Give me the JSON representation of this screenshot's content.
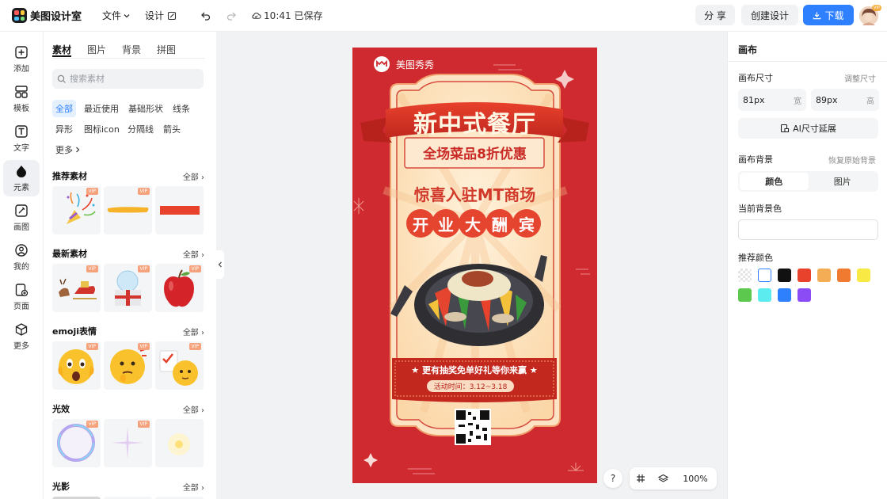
{
  "app": {
    "name": "美图设计室"
  },
  "menu": {
    "file": "文件",
    "design": "设计",
    "save_status": "10:41 已保存"
  },
  "actions": {
    "share": "分 享",
    "create": "创建设计",
    "download": "下载"
  },
  "user": {
    "vip": "VIP"
  },
  "rail": [
    {
      "label": "添加",
      "icon": "plus-square-icon"
    },
    {
      "label": "模板",
      "icon": "template-icon"
    },
    {
      "label": "文字",
      "icon": "text-icon"
    },
    {
      "label": "元素",
      "icon": "shapes-icon"
    },
    {
      "label": "画图",
      "icon": "draw-icon"
    },
    {
      "label": "我的",
      "icon": "user-icon"
    },
    {
      "label": "页面",
      "icon": "page-icon"
    },
    {
      "label": "更多",
      "icon": "cube-icon"
    }
  ],
  "panel": {
    "tabs": [
      "素材",
      "图片",
      "背景",
      "拼图"
    ],
    "search_placeholder": "搜索素材",
    "filters": [
      "全部",
      "最近使用",
      "基础形状",
      "线条",
      "异形",
      "图标icon",
      "分隔线",
      "箭头",
      "更多"
    ],
    "see_all": "全部",
    "vip_badge": "VIP",
    "sections": [
      {
        "title": "推荐素材",
        "items": [
          "party-popper",
          "brush-stroke",
          "red-bar"
        ]
      },
      {
        "title": "最新素材",
        "items": [
          "reindeer-sleigh",
          "snow-globe-gift",
          "red-apple"
        ]
      },
      {
        "title": "emoji表情",
        "items": [
          "shocked-emoji",
          "thinking-emoji",
          "checklist-emoji"
        ]
      },
      {
        "title": "光效",
        "items": [
          "light-bubble",
          "star-sparkle",
          "glow-spot"
        ]
      },
      {
        "title": "光影"
      }
    ]
  },
  "poster": {
    "brand": "美图秀秀",
    "headline": "新中式餐厅",
    "subheadline": "全场菜品8折优惠",
    "tagline": "惊喜入驻MT商场",
    "grand_opening": [
      "开",
      "业",
      "大",
      "酬",
      "宾"
    ],
    "banner": "★ 更有抽奖免单好礼等你来赢 ★",
    "event_time": "活动时间：3.12~3.18",
    "colors": {
      "primary": "#cf2a2f",
      "cream": "#fde3bf",
      "gold": "#f6c98f"
    }
  },
  "zoom": {
    "level": "100%",
    "help": "?"
  },
  "canvas_panel": {
    "title": "画布",
    "size_label": "画布尺寸",
    "resize_link": "调整尺寸",
    "width_value": "81px",
    "width_unit": "宽",
    "height_value": "89px",
    "height_unit": "高",
    "ai_extend": "AI尺寸延展",
    "bg_label": "画布背景",
    "restore_link": "恢复原始背景",
    "bg_modes": [
      "颜色",
      "图片"
    ],
    "current_bg_label": "当前背景色",
    "recommended_label": "推荐颜色",
    "swatches": [
      "transparent",
      "#ffffff",
      "#111111",
      "#e8412c",
      "#f5ad55",
      "#f07a2f",
      "#f8e944",
      "#5cc84d",
      "#5cecf0",
      "#2f80ff",
      "#8b4cf5"
    ]
  }
}
